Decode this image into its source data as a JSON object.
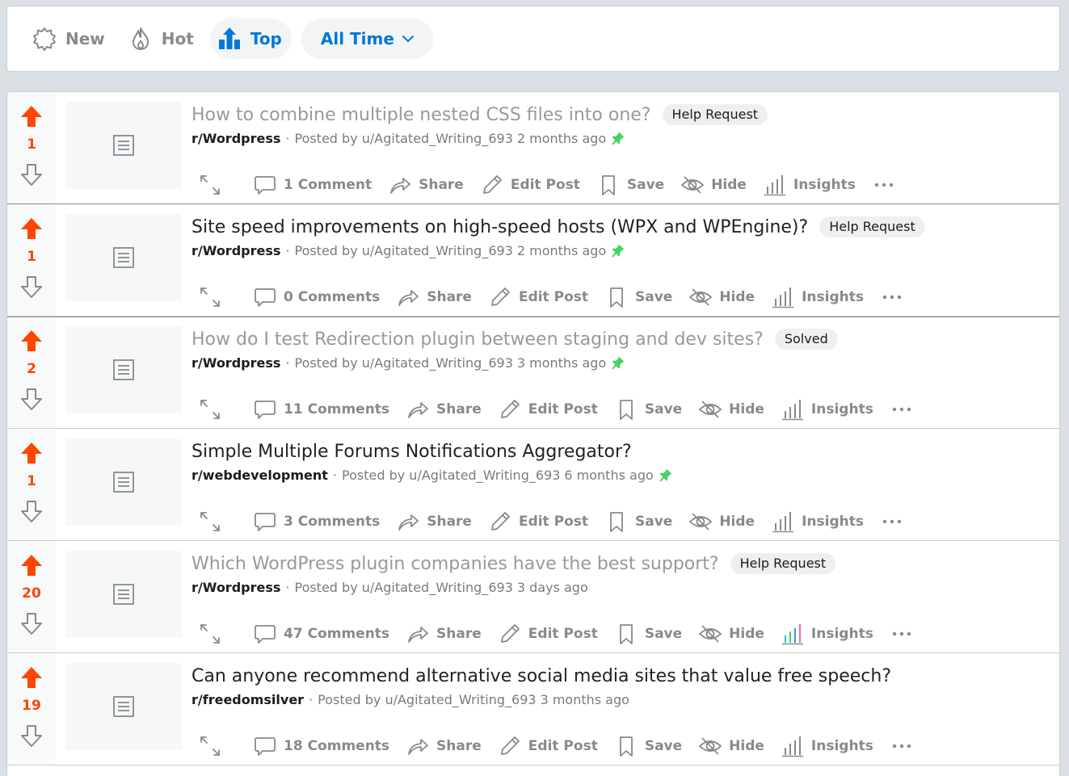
{
  "sort": {
    "new_label": "New",
    "hot_label": "Hot",
    "top_label": "Top",
    "range_label": "All Time",
    "active": "top"
  },
  "colors": {
    "upvote": "#ff4500",
    "accent": "#0079d3",
    "pin": "#46d160",
    "muted": "#878a8c"
  },
  "posts": [
    {
      "votes": "1",
      "title": "How to combine multiple nested CSS files into one?",
      "visited": true,
      "flair": "Help Request",
      "subreddit": "r/Wordpress",
      "posted_by": "Posted by u/Agitated_Writing_693",
      "age": "2 months ago",
      "pinned": true,
      "comments": "1 Comment",
      "share": "Share",
      "edit": "Edit Post",
      "save": "Save",
      "hide": "Hide",
      "insights": "Insights",
      "insights_colored": false
    },
    {
      "votes": "1",
      "title": "Site speed improvements on high-speed hosts (WPX and WPEngine)?",
      "visited": false,
      "flair": "Help Request",
      "subreddit": "r/Wordpress",
      "posted_by": "Posted by u/Agitated_Writing_693",
      "age": "2 months ago",
      "pinned": true,
      "comments": "0 Comments",
      "share": "Share",
      "edit": "Edit Post",
      "save": "Save",
      "hide": "Hide",
      "insights": "Insights",
      "insights_colored": false
    },
    {
      "votes": "2",
      "title": "How do I test Redirection plugin between staging and dev sites?",
      "visited": true,
      "flair": "Solved",
      "subreddit": "r/Wordpress",
      "posted_by": "Posted by u/Agitated_Writing_693",
      "age": "3 months ago",
      "pinned": true,
      "comments": "11 Comments",
      "share": "Share",
      "edit": "Edit Post",
      "save": "Save",
      "hide": "Hide",
      "insights": "Insights",
      "insights_colored": false
    },
    {
      "votes": "1",
      "title": "Simple Multiple Forums Notifications Aggregator?",
      "visited": false,
      "flair": "",
      "subreddit": "r/webdevelopment",
      "posted_by": "Posted by u/Agitated_Writing_693",
      "age": "6 months ago",
      "pinned": true,
      "comments": "3 Comments",
      "share": "Share",
      "edit": "Edit Post",
      "save": "Save",
      "hide": "Hide",
      "insights": "Insights",
      "insights_colored": false
    },
    {
      "votes": "20",
      "title": "Which WordPress plugin companies have the best support?",
      "visited": true,
      "flair": "Help Request",
      "subreddit": "r/Wordpress",
      "posted_by": "Posted by u/Agitated_Writing_693",
      "age": "3 days ago",
      "pinned": false,
      "comments": "47 Comments",
      "share": "Share",
      "edit": "Edit Post",
      "save": "Save",
      "hide": "Hide",
      "insights": "Insights",
      "insights_colored": true
    },
    {
      "votes": "19",
      "title": "Can anyone recommend alternative social media sites that value free speech?",
      "visited": false,
      "flair": "",
      "subreddit": "r/freedomsilver",
      "posted_by": "Posted by u/Agitated_Writing_693",
      "age": "3 months ago",
      "pinned": false,
      "comments": "18 Comments",
      "share": "Share",
      "edit": "Edit Post",
      "save": "Save",
      "hide": "Hide",
      "insights": "Insights",
      "insights_colored": false
    }
  ]
}
